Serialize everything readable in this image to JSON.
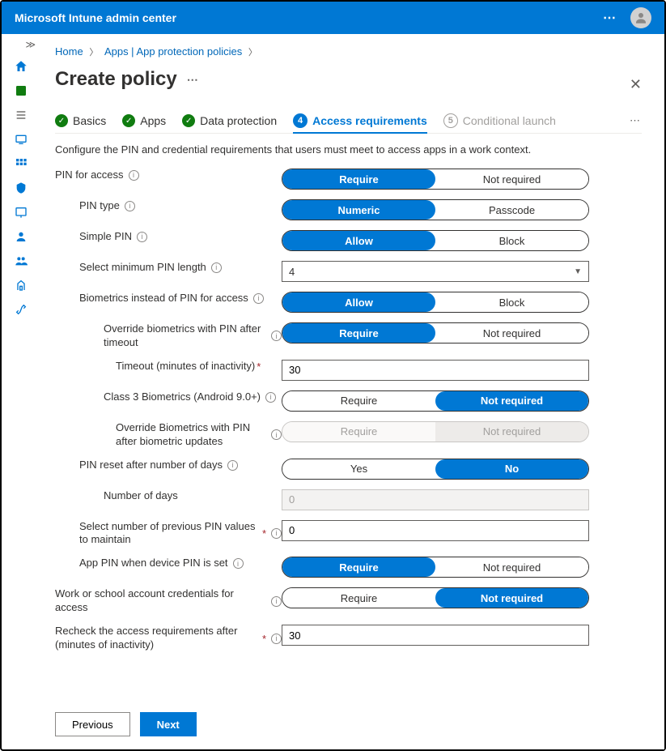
{
  "header": {
    "title": "Microsoft Intune admin center"
  },
  "breadcrumbs": {
    "home": "Home",
    "apps": "Apps | App protection policies"
  },
  "page": {
    "title": "Create policy",
    "intro": "Configure the PIN and credential requirements that users must meet to access apps in a work context."
  },
  "wizard": {
    "step1": "Basics",
    "step2": "Apps",
    "step3": "Data protection",
    "step4_num": "4",
    "step4": "Access requirements",
    "step5_num": "5",
    "step5": "Conditional launch"
  },
  "rows": {
    "pin_access": {
      "label": "PIN for access",
      "opt1": "Require",
      "opt2": "Not required"
    },
    "pin_type": {
      "label": "PIN type",
      "opt1": "Numeric",
      "opt2": "Passcode"
    },
    "simple_pin": {
      "label": "Simple PIN",
      "opt1": "Allow",
      "opt2": "Block"
    },
    "min_length": {
      "label": "Select minimum PIN length",
      "value": "4"
    },
    "biometrics": {
      "label": "Biometrics instead of PIN for access",
      "opt1": "Allow",
      "opt2": "Block"
    },
    "override_timeout": {
      "label": "Override biometrics with PIN after timeout",
      "opt1": "Require",
      "opt2": "Not required"
    },
    "timeout": {
      "label": "Timeout (minutes of inactivity)",
      "value": "30"
    },
    "class3": {
      "label": "Class 3 Biometrics (Android 9.0+)",
      "opt1": "Require",
      "opt2": "Not required"
    },
    "override_update": {
      "label": "Override Biometrics with PIN after biometric updates",
      "opt1": "Require",
      "opt2": "Not required"
    },
    "pin_reset": {
      "label": "PIN reset after number of days",
      "opt1": "Yes",
      "opt2": "No"
    },
    "num_days": {
      "label": "Number of days",
      "value": "0"
    },
    "prev_values": {
      "label": "Select number of previous PIN values to maintain",
      "value": "0"
    },
    "app_pin": {
      "label": "App PIN when device PIN is set",
      "opt1": "Require",
      "opt2": "Not required"
    },
    "work_creds": {
      "label": "Work or school account credentials for access",
      "opt1": "Require",
      "opt2": "Not required"
    },
    "recheck": {
      "label": "Recheck the access requirements after (minutes of inactivity)",
      "value": "30"
    }
  },
  "footer": {
    "prev": "Previous",
    "next": "Next"
  }
}
